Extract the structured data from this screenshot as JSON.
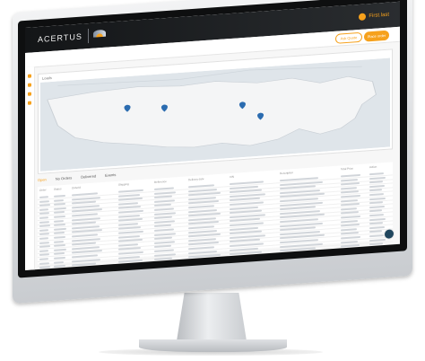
{
  "app": {
    "brand": "ACERTUS",
    "user_name": "First.last",
    "buttons": {
      "outline": "Ask Quote",
      "primary": "Place order"
    }
  },
  "map": {
    "title": "Loads",
    "pins": [
      {
        "lon": -111.9,
        "lat": 40.7
      },
      {
        "lon": -104.9,
        "lat": 39.7
      },
      {
        "lon": -90.2,
        "lat": 38.6
      },
      {
        "lon": -86.8,
        "lat": 33.5
      }
    ]
  },
  "tabs": [
    "Open",
    "No Orders",
    "Delivered",
    "Events"
  ],
  "table": {
    "headers": [
      "Order",
      "Status",
      "Orderid",
      "Shipping",
      "Reference",
      "Delivery date",
      "VIN",
      "Description",
      "Total Price",
      "Action"
    ],
    "row_count": 24
  },
  "colors": {
    "accent": "#f6a11c",
    "topbar": "#131517"
  }
}
